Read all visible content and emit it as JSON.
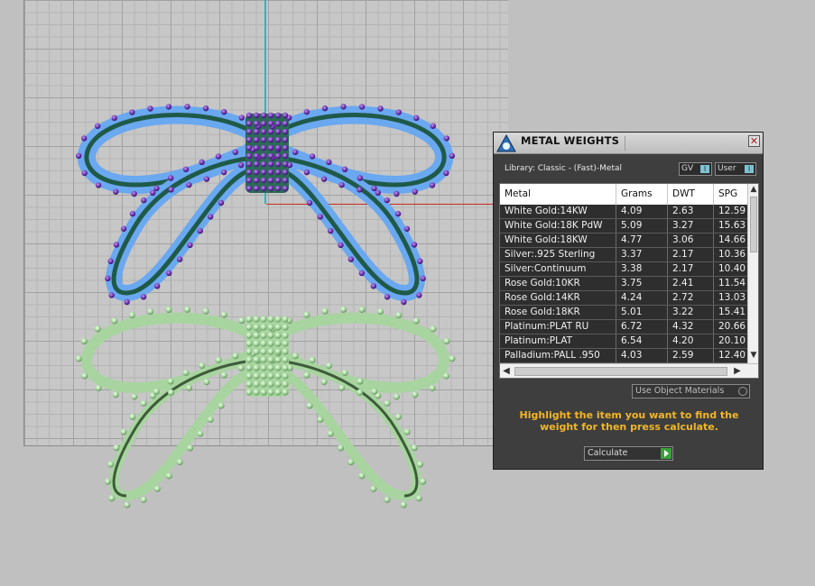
{
  "panel": {
    "title": "METAL WEIGHTS",
    "close_glyph": "✕",
    "library_label": "Library: Classic - (Fast)-Metal",
    "toggle_gv": "GV",
    "toggle_user": "User",
    "toggle_knob_glyph": "I"
  },
  "table": {
    "columns": [
      "Metal",
      "Grams",
      "DWT",
      "SPG"
    ],
    "rows": [
      [
        "White Gold:14KW",
        "4.09",
        "2.63",
        "12.59"
      ],
      [
        "White Gold:18K PdW",
        "5.09",
        "3.27",
        "15.63"
      ],
      [
        "White Gold:18KW",
        "4.77",
        "3.06",
        "14.66"
      ],
      [
        "Silver:.925 Sterling",
        "3.37",
        "2.17",
        "10.36"
      ],
      [
        "Silver:Continuum",
        "3.38",
        "2.17",
        "10.40"
      ],
      [
        "Rose Gold:10KR",
        "3.75",
        "2.41",
        "11.54"
      ],
      [
        "Rose Gold:14KR",
        "4.24",
        "2.72",
        "13.03"
      ],
      [
        "Rose Gold:18KR",
        "5.01",
        "3.22",
        "15.41"
      ],
      [
        "Platinum:PLAT RU",
        "6.72",
        "4.32",
        "20.66"
      ],
      [
        "Platinum:PLAT",
        "6.54",
        "4.20",
        "20.10"
      ],
      [
        "Palladium:PALL .950",
        "4.03",
        "2.59",
        "12.40"
      ]
    ]
  },
  "scroll": {
    "up": "▲",
    "down": "▼",
    "left": "◀",
    "right": "▶"
  },
  "controls": {
    "use_object_materials": "Use Object Materials",
    "hint": "Highlight the item you want to find the weight for then press calculate.",
    "calculate": "Calculate"
  },
  "colors": {
    "panel_bg": "#3e3e3e",
    "hint": "#f2b626",
    "axis_y": "#2ab7c6",
    "axis_x": "#c62b1f",
    "bow_top_metal": "#1f5a49",
    "bow_top_stones": "#6aa8f0",
    "bow_top_prongs": "#5a1f9a",
    "bow_bottom": "#a8d4a0"
  },
  "icons": {
    "logo": "rhino-logo-icon",
    "close": "close-icon",
    "calculate_arrow": "play-arrow-icon"
  }
}
